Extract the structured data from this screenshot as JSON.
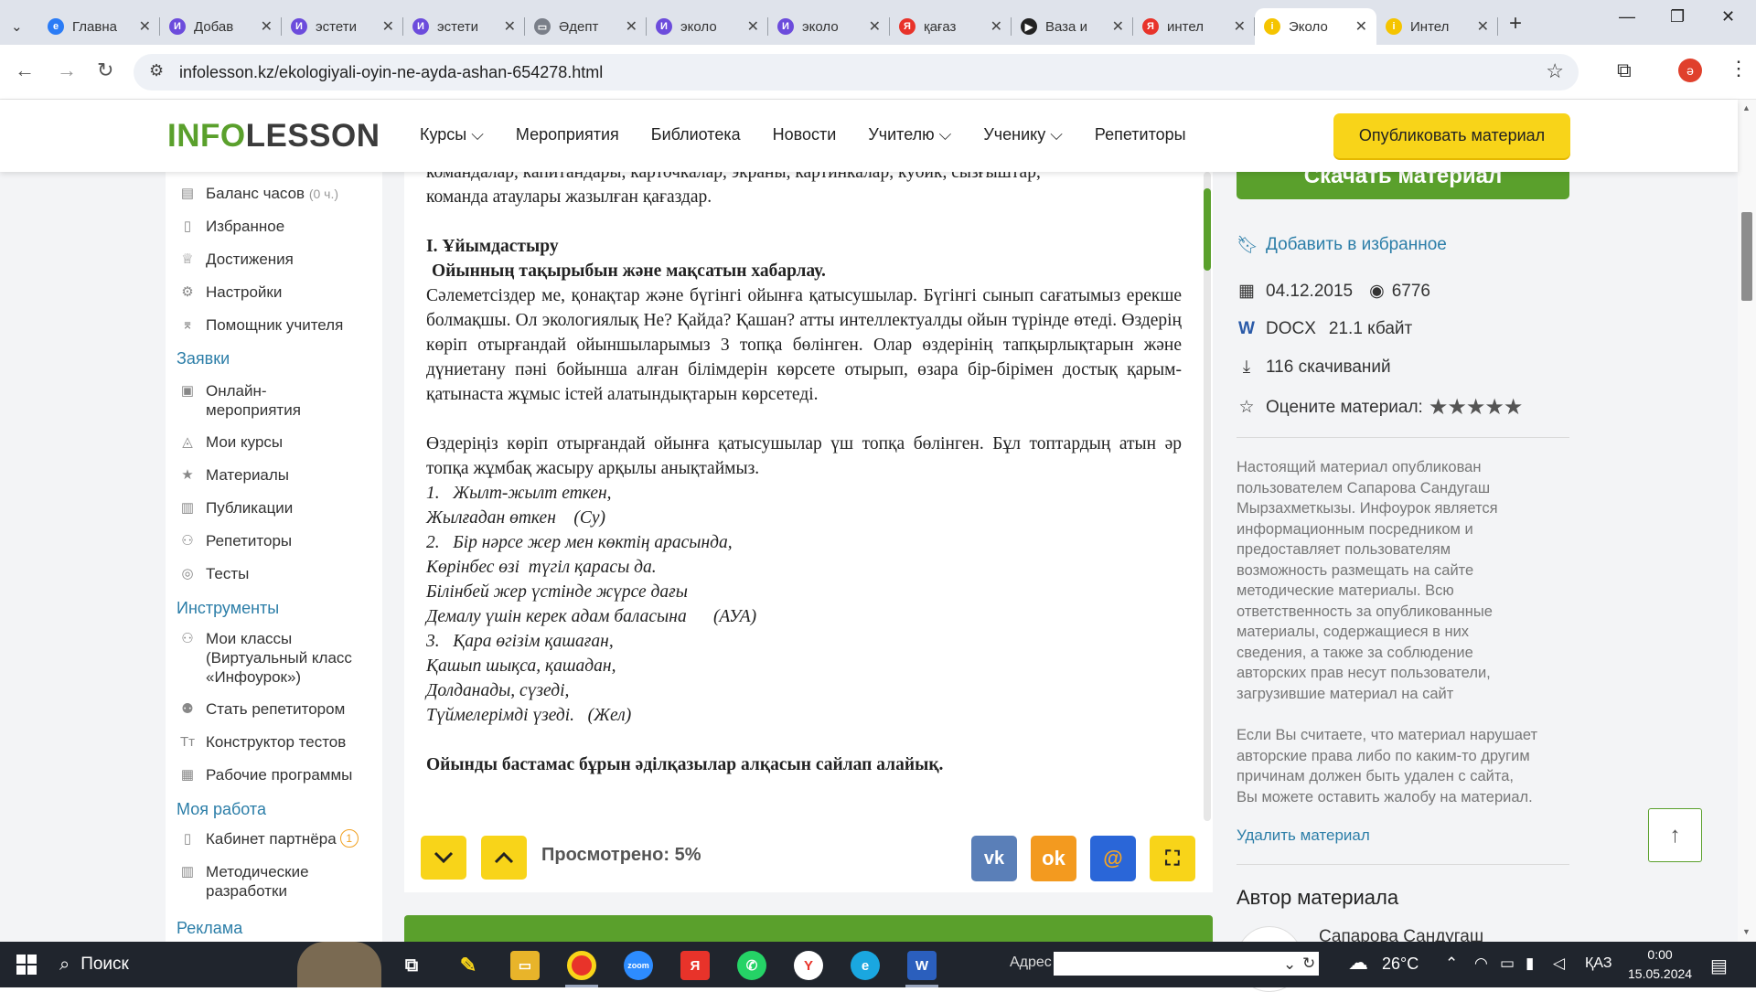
{
  "browser": {
    "tabs": [
      {
        "label": "Главна",
        "fav": "e",
        "color": "#2b7cf6"
      },
      {
        "label": "Добав",
        "fav": "И",
        "color": "#6c4cdc"
      },
      {
        "label": "эстети",
        "fav": "И",
        "color": "#6c4cdc"
      },
      {
        "label": "эстети",
        "fav": "И",
        "color": "#6c4cdc"
      },
      {
        "label": "Әдепт",
        "fav": "▭",
        "color": "#7a7f89"
      },
      {
        "label": "эколо",
        "fav": "И",
        "color": "#6c4cdc"
      },
      {
        "label": "эколо",
        "fav": "И",
        "color": "#6c4cdc"
      },
      {
        "label": "қағаз",
        "fav": "Я",
        "color": "#e8332a"
      },
      {
        "label": "Ваза и",
        "fav": "▶",
        "color": "#222"
      },
      {
        "label": "интел",
        "fav": "Я",
        "color": "#e8332a"
      },
      {
        "label": "Эколо",
        "fav": "i",
        "color": "#f5c400",
        "active": true
      },
      {
        "label": "Интел",
        "fav": "i",
        "color": "#f5c400"
      }
    ],
    "url": "infolesson.kz/ekologiyali-oyin-ne-ayda-ashan-654278.html",
    "profile_initial": "ә"
  },
  "site": {
    "logo_green": "INFO",
    "logo_dark": "LESSON",
    "menu": [
      "Курсы",
      "Мероприятия",
      "Библиотека",
      "Новости",
      "Учителю",
      "Ученику",
      "Репетиторы"
    ],
    "publish_label": "Опубликовать материал"
  },
  "sidebar": {
    "balance": "Баланс часов",
    "balance_sub": "(0 ч.)",
    "items_top": [
      "Избранное",
      "Достижения",
      "Настройки",
      "Помощник учителя"
    ],
    "head_requests": "Заявки",
    "items_requests": [
      "Онлайн-\nмероприятия",
      "Мои курсы",
      "Материалы",
      "Публикации",
      "Репетиторы",
      "Тесты"
    ],
    "head_tools": "Инструменты",
    "items_tools": [
      "Мои классы (Виртуальный класс «Инфоурок»)",
      "Стать репетитором",
      "Конструктор тестов",
      "Рабочие программы"
    ],
    "head_work": "Моя работа",
    "partner": "Кабинет партнёра",
    "partner_badge": "1",
    "method": "Методические разработки",
    "head_ads": "Реклама"
  },
  "doc": {
    "line0": "командалар, капитандары, карточкалар, экраны, картинкалар, кубик, сызғыштар,",
    "line1": "команда атаулары жазылған қағаздар.",
    "h1": "I. Ұйымдастыру",
    "h2": "Ойынның тақырыбын және мақсатын хабарлау.",
    "p1": "Сәлеметсіздер ме, қонақтар және бүгінгі ойынға қатысушылар. Бүгінгі сынып сағатымыз ерекше болмақшы. Ол экологиялық Не? Қайда? Қашан? атты интеллектуалды ойын түрінде өтеді. Өздерің көріп отырғандай ойыншыларымыз 3 топқа бөлінген. Олар өздерінің тапқырлықтарын және дүниетану пәні бойынша алған білімдерін көрсете отырып, өзара бір-бірімен достық қарым-қатынаста жұмыс істей алатындықтарын көрсетеді.",
    "p2": "Өздеріңіз көріп отырғандай  ойынға қатысушылар үш топқа бөлінген. Бұл топтардың атын әр топқа жұмбақ жасыру арқылы анықтаймыз.",
    "riddles": [
      "1.   Жылт-жылт еткен,",
      "Жылғадан өткен    (Су)",
      "2.   Бір нәрсе жер мен көктің арасында,",
      "Көрінбес өзі  түгіл қарасы да.",
      "Білінбей жер үстінде жүрсе дағы",
      "Демалу үшін керек адам баласына      (АУА)",
      "3.   Қара өгізім қашаған,",
      "Қашып шықса, қашадан,",
      "Долданады, сүзеді,",
      "Түймелерімді үзеді.   (Жел)"
    ],
    "closing": "Ойынды бастамас бұрын әділқазылар алқасын сайлап алайық.",
    "viewed": "Просмотрено: 5%"
  },
  "right": {
    "download": "Скачать материал",
    "favorite": "Добавить в избранное",
    "date": "04.12.2015",
    "views": "6776",
    "format": "DOCX",
    "size": "21.1 кбайт",
    "downloads": "116 скачиваний",
    "rate_label": "Оцените материал:",
    "note1": "Настоящий материал опубликован пользователем Сапарова Сандугаш Мырзахметкызы. Инфоурок является информационным посредником и предоставляет пользователям возможность размещать на сайте методические материалы. Всю ответственность за опубликованные материалы, содержащиеся в них сведения, а также за соблюдение авторских прав несут пользователи, загрузившие материал на сайт",
    "note2": "Если Вы считаете, что материал нарушает авторские права либо по каким-то другим причинам должен быть удален с сайта, Вы можете оставить жалобу на материал.",
    "delete": "Удалить материал",
    "author_head": "Автор материала",
    "author_name": "Сапарова Сандугаш"
  },
  "taskbar": {
    "search": "Поиск",
    "addr_label": "Адрес",
    "temp": "26°C",
    "lang": "ҚАЗ",
    "time": "0:00",
    "date": "15.05.2024"
  }
}
